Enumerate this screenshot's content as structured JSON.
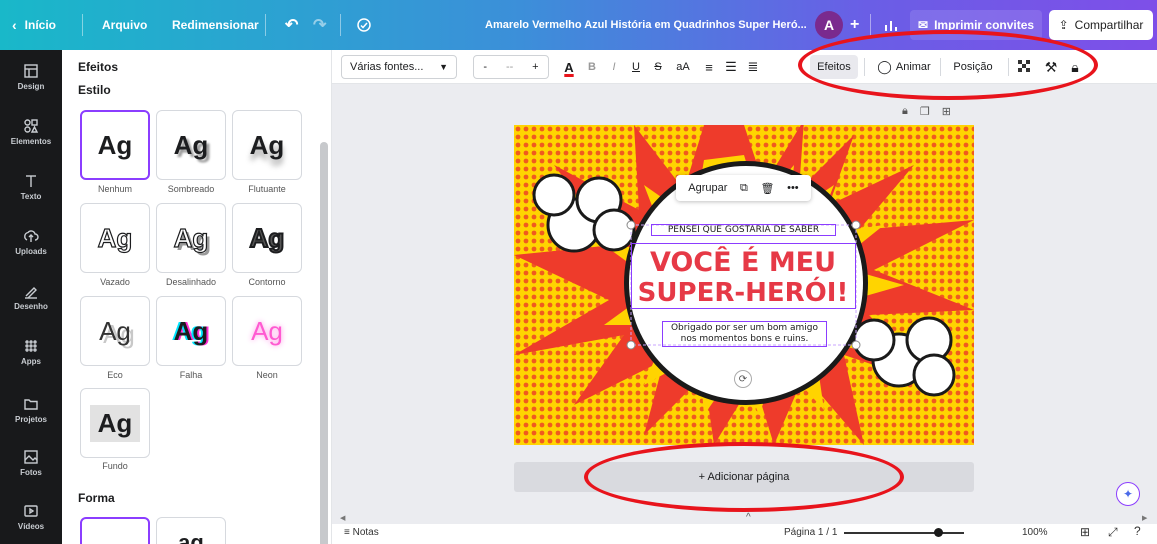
{
  "topbar": {
    "back_label": "Início",
    "file_label": "Arquivo",
    "resize_label": "Redimensionar",
    "doc_title": "Amarelo Vermelho Azul História em Quadrinhos Super Heró...",
    "avatar_initial": "A",
    "print_label": "Imprimir convites",
    "share_label": "Compartilhar"
  },
  "rail": {
    "items": [
      {
        "label": "Design",
        "icon": "design-icon"
      },
      {
        "label": "Elementos",
        "icon": "elements-icon"
      },
      {
        "label": "Texto",
        "icon": "text-icon"
      },
      {
        "label": "Uploads",
        "icon": "upload-icon"
      },
      {
        "label": "Desenho",
        "icon": "draw-icon"
      },
      {
        "label": "Apps",
        "icon": "apps-icon"
      },
      {
        "label": "Projetos",
        "icon": "folder-icon"
      },
      {
        "label": "Fotos",
        "icon": "photo-icon"
      },
      {
        "label": "Vídeos",
        "icon": "video-icon"
      }
    ]
  },
  "panel": {
    "title": "Efeitos",
    "style_heading": "Estilo",
    "shape_heading": "Forma",
    "styles": [
      {
        "label": "Nenhum",
        "sample": "Ag"
      },
      {
        "label": "Sombreado",
        "sample": "Ag"
      },
      {
        "label": "Flutuante",
        "sample": "Ag"
      },
      {
        "label": "Vazado",
        "sample": "Ag"
      },
      {
        "label": "Desalinhado",
        "sample": "Ag"
      },
      {
        "label": "Contorno",
        "sample": "Ag"
      },
      {
        "label": "Eco",
        "sample": "Ag"
      },
      {
        "label": "Falha",
        "sample": "Ag"
      },
      {
        "label": "Neon",
        "sample": "Ag"
      },
      {
        "label": "Fundo",
        "sample": "Ag"
      }
    ],
    "shape_sample": "ag"
  },
  "toolbar": {
    "font": "Várias fontes...",
    "size_minus": "-",
    "size_value": "-- ",
    "size_plus": "+",
    "text_color": "A",
    "bold": "B",
    "italic": "I",
    "underline": "U",
    "strike": "S",
    "case": "aA",
    "effects_label": "Efeitos",
    "animate_label": "Animar",
    "position_label": "Posição"
  },
  "canvas": {
    "group_label": "Agrupar",
    "more_label": "•••",
    "small_text": "PENSEI QUE GOSTARIA DE SABER",
    "headline_1": "VOCÊ É MEU",
    "headline_2": "SUPER-HERÓI!",
    "body_1": "Obrigado por ser um bom amigo",
    "body_2": "nos momentos bons e ruins.",
    "add_page_label": "+ Adicionar página"
  },
  "footer": {
    "notes_label": "Notas",
    "page_label": "Página 1 / 1",
    "zoom_label": "100%"
  },
  "colors": {
    "accent": "#8b3dff",
    "headline_red": "#e63946",
    "comic_yellow": "#ffd400",
    "comic_red": "#ee3b2b"
  }
}
